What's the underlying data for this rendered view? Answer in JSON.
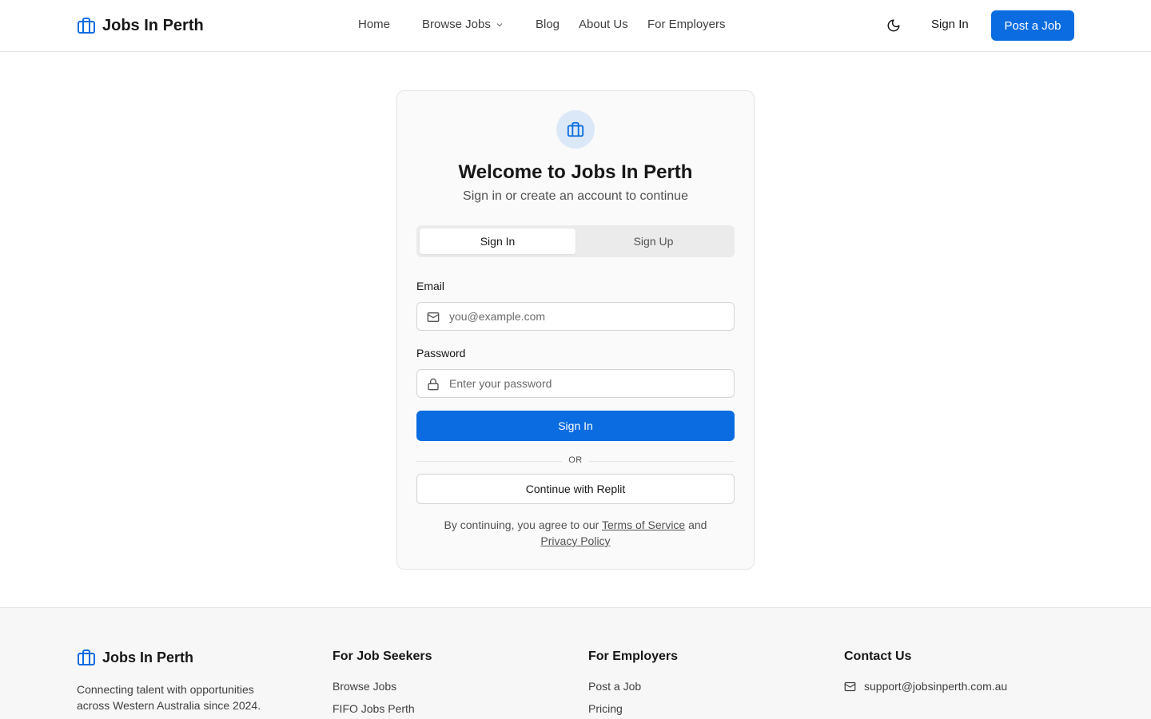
{
  "header": {
    "brand": "Jobs In Perth",
    "nav": [
      "Home",
      "Browse Jobs",
      "Blog",
      "About Us",
      "For Employers"
    ],
    "signin_label": "Sign In",
    "post_job_label": "Post a Job"
  },
  "auth": {
    "title": "Welcome to Jobs In Perth",
    "subtitle": "Sign in or create an account to continue",
    "tabs": [
      "Sign In",
      "Sign Up"
    ],
    "active_tab": "Sign In",
    "email_label": "Email",
    "email_placeholder": "you@example.com",
    "email_value": "",
    "password_label": "Password",
    "password_placeholder": "Enter your password",
    "password_value": "",
    "submit_label": "Sign In",
    "divider_text": "OR",
    "replit_label": "Continue with Replit",
    "legal_prefix": "By continuing, you agree to our",
    "terms_label": "Terms of Service",
    "legal_and": "and",
    "privacy_label": "Privacy Policy"
  },
  "footer": {
    "brand": "Jobs In Perth",
    "tagline": "Connecting talent with opportunities across Western Australia since 2024.",
    "job_seekers": {
      "heading": "For Job Seekers",
      "links": [
        "Browse Jobs",
        "FIFO Jobs Perth"
      ]
    },
    "employers": {
      "heading": "For Employers",
      "links": [
        "Post a Job",
        "Pricing"
      ]
    },
    "contact": {
      "heading": "Contact Us",
      "email": "support@jobsinperth.com.au"
    }
  },
  "icons": {
    "brand": "briefcase-icon",
    "theme": "moon-icon",
    "email": "mail-icon",
    "password": "lock-icon",
    "dropdown": "chevron-down-icon"
  },
  "colors": {
    "accent": "#0a6ce0",
    "icon_bg": "#dbe8f7"
  }
}
